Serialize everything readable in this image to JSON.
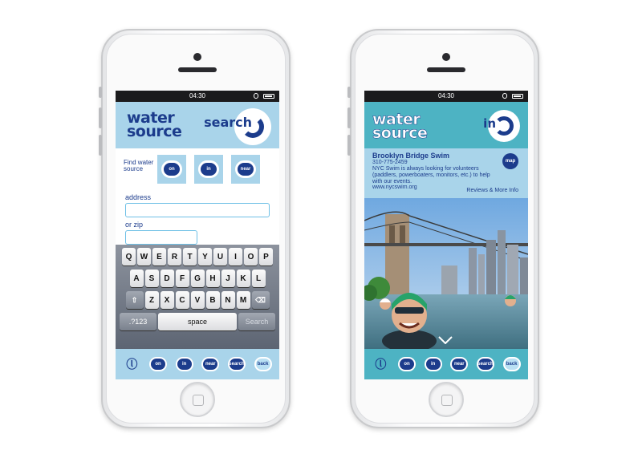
{
  "status_time": "04:30",
  "brand": {
    "line1": "water",
    "line2": "source"
  },
  "left_screen": {
    "header_word": "search",
    "find_label": "Find water source",
    "modes": [
      "on",
      "in",
      "near"
    ],
    "address_label": "address",
    "address_value": "",
    "zip_label": "or zip",
    "zip_value": "",
    "keyboard": {
      "row1": [
        "Q",
        "W",
        "E",
        "R",
        "T",
        "Y",
        "U",
        "I",
        "O",
        "P"
      ],
      "row2": [
        "A",
        "S",
        "D",
        "F",
        "G",
        "H",
        "J",
        "K",
        "L"
      ],
      "row3": [
        "Z",
        "X",
        "C",
        "V",
        "B",
        "N",
        "M"
      ],
      "num_key": ".?123",
      "space_key": "space",
      "search_key": "Search"
    }
  },
  "right_screen": {
    "header_word": "in",
    "event_title": "Brooklyn Bridge Swim",
    "phone": "310-775-2459",
    "description": "NYC Swim is always looking for volunteers (paddlers, powerboaters, monitors, etc.) to help with our events.",
    "website": "www.nycswim.org",
    "map_label": "map",
    "more_link": "Reviews & More Info"
  },
  "nav": {
    "items": [
      "on",
      "in",
      "near",
      "search",
      "back"
    ]
  },
  "colors": {
    "navy": "#1c3c8c",
    "light_blue": "#a9d4ea",
    "teal": "#4db3c3"
  }
}
